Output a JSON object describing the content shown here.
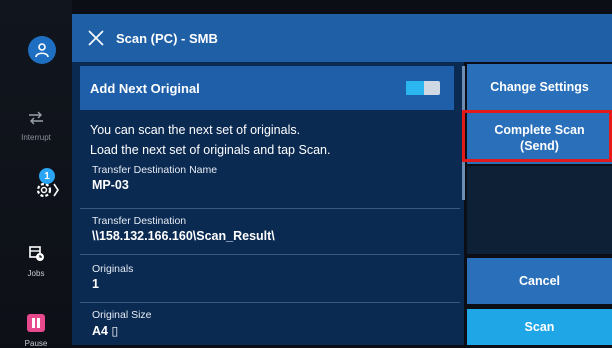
{
  "header": {
    "title": "Scan (PC) - SMB"
  },
  "sidebar": {
    "interrupt_label": "Interrupt",
    "settings_badge": "1",
    "jobs_label": "Jobs",
    "pause_label": "Pause"
  },
  "panel": {
    "add_next_label": "Add Next Original",
    "message_line1": "You can scan the next set of originals.",
    "message_line2": "Load the next set of originals and tap Scan.",
    "rows": [
      {
        "label": "Transfer Destination Name",
        "value": "MP-03"
      },
      {
        "label": "Transfer Destination",
        "value": "\\\\158.132.166.160\\Scan_Result\\"
      },
      {
        "label": "Originals",
        "value": "1"
      },
      {
        "label": "Original Size",
        "value": "A4 ▯"
      }
    ]
  },
  "buttons": {
    "change_settings": "Change Settings",
    "complete_scan_line1": "Complete Scan",
    "complete_scan_line2": "(Send)",
    "cancel": "Cancel",
    "scan": "Scan"
  },
  "colors": {
    "titlebar": "#1e5fa6",
    "panel": "#0b2a52",
    "button": "#2a6fba",
    "scan": "#1fa6e6",
    "highlight": "#e21a1a"
  }
}
